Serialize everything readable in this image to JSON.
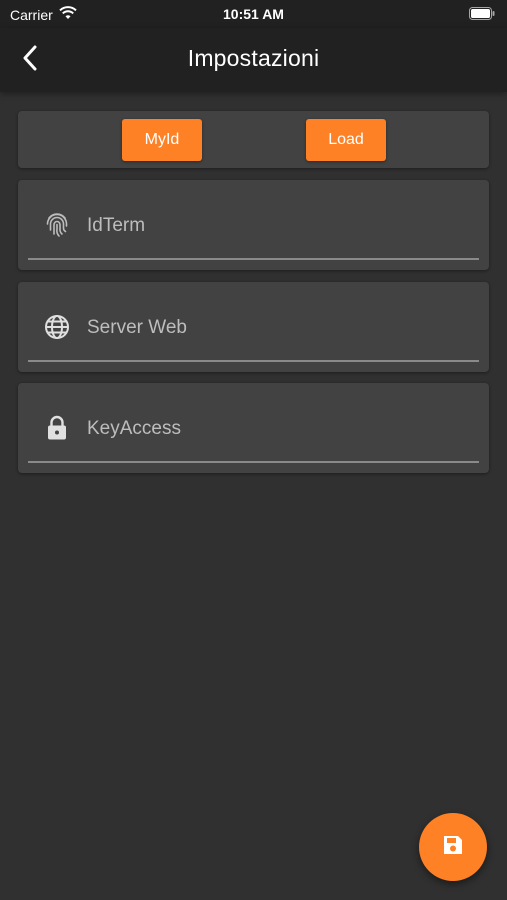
{
  "status_bar": {
    "carrier": "Carrier",
    "time": "10:51 AM"
  },
  "app_bar": {
    "title": "Impostazioni",
    "back_icon": "chevron-left-icon"
  },
  "actions": {
    "myid_label": "MyId",
    "load_label": "Load"
  },
  "fields": [
    {
      "placeholder": "IdTerm",
      "icon": "fingerprint-icon"
    },
    {
      "placeholder": "Server Web",
      "icon": "globe-icon"
    },
    {
      "placeholder": "KeyAccess",
      "icon": "lock-icon"
    }
  ],
  "fab": {
    "icon": "save-icon"
  },
  "colors": {
    "accent": "#ff8125",
    "background": "#303030",
    "card": "#424242",
    "app_bar": "#212121"
  }
}
